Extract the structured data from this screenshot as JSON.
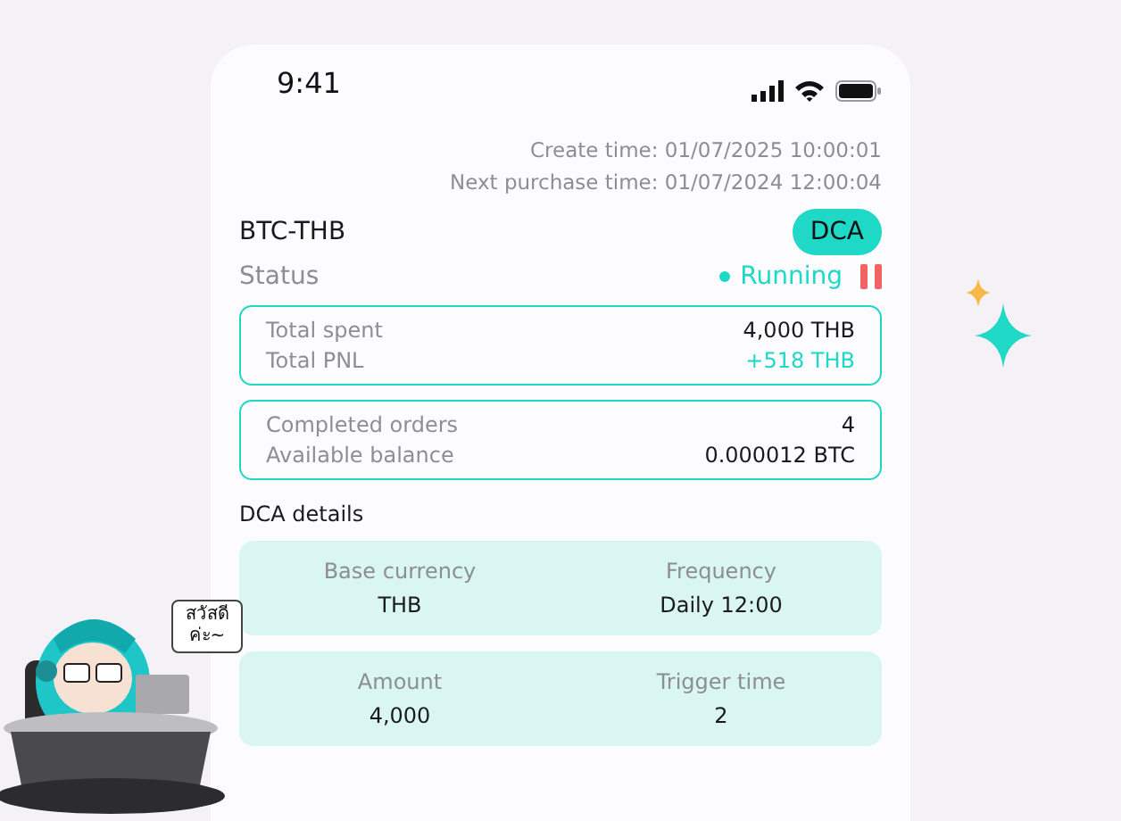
{
  "status_bar": {
    "time": "9:41"
  },
  "header": {
    "create_time": "Create time: 01/07/2025 10:00:01",
    "next_purchase_time": "Next purchase time: 01/07/2024 12:00:04"
  },
  "pair": "BTC-THB",
  "strategy_badge": "DCA",
  "status": {
    "label": "Status",
    "value": "Running",
    "kind": "running"
  },
  "summary_cards": [
    {
      "rows": [
        {
          "label": "Total spent",
          "value": "4,000 THB",
          "kind": "plain"
        },
        {
          "label": "Total PNL",
          "value": "+518 THB",
          "kind": "positive"
        }
      ]
    },
    {
      "rows": [
        {
          "label": "Completed orders",
          "value": "4",
          "kind": "plain"
        },
        {
          "label": "Available balance",
          "value": "0.000012 BTC",
          "kind": "plain"
        }
      ]
    }
  ],
  "details": {
    "title": "DCA details",
    "cards": [
      {
        "items": [
          {
            "label": "Base currency",
            "value": "THB"
          },
          {
            "label": "Frequency",
            "value": "Daily 12:00"
          }
        ]
      },
      {
        "items": [
          {
            "label": "Amount",
            "value": "4,000"
          },
          {
            "label": "Trigger time",
            "value": "2"
          }
        ]
      }
    ]
  },
  "mascot": {
    "speech": "สวัสดี ค่ะ~"
  }
}
